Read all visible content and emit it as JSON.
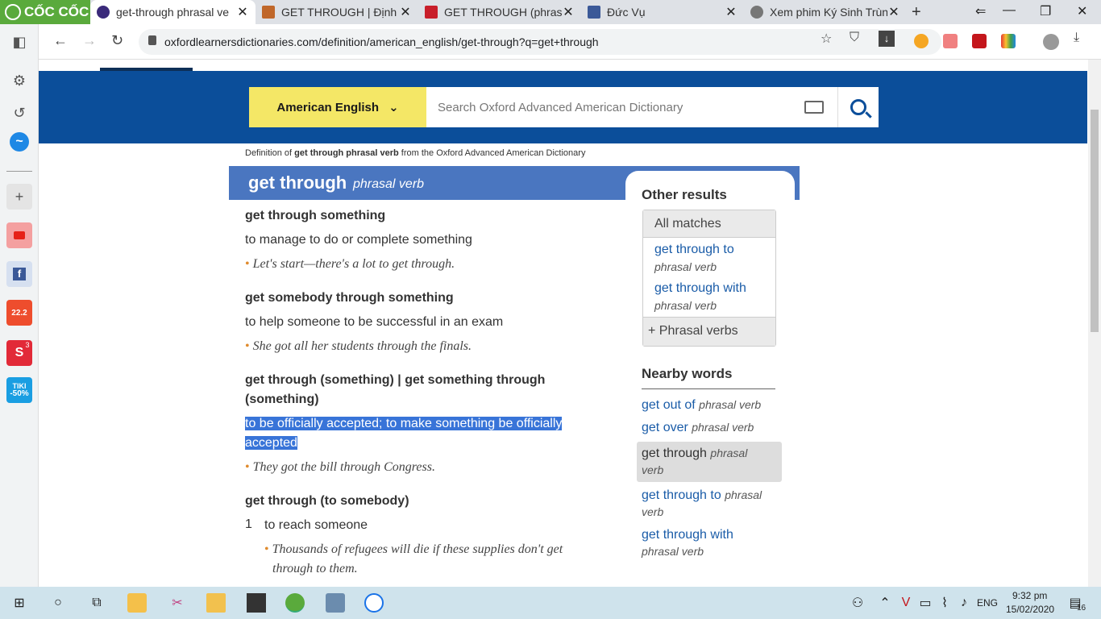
{
  "browser": {
    "brand": "CỐC CỐC",
    "tabs": [
      {
        "title": "get-through phrasal ve",
        "active": true
      },
      {
        "title": "GET THROUGH | Định n"
      },
      {
        "title": "GET THROUGH (phrasal"
      },
      {
        "title": "Đức Vụ"
      },
      {
        "title": "Xem phim Ký Sinh Trùng"
      }
    ],
    "url": "oxfordlearnersdictionaries.com/definition/american_english/get-through?q=get+through"
  },
  "site": {
    "dictionary_select": "American English",
    "search_placeholder": "Search Oxford Advanced American Dictionary",
    "definition_line": {
      "prefix": "Definition of ",
      "bold": "get through phrasal verb",
      "suffix": " from the Oxford Advanced American Dictionary"
    },
    "headword": "get through",
    "pos": "phrasal verb"
  },
  "entries": [
    {
      "phrase": "get through something",
      "definition": "to manage to do or complete something",
      "example": "Let's start—there's a lot to get through."
    },
    {
      "phrase": "get somebody through something",
      "definition": "to help someone to be successful in an exam",
      "example": "She got all her students through the finals."
    },
    {
      "phrase_line1": "get through (something) | get something through",
      "phrase_line2": "(something)",
      "definition_line1": "to be officially accepted; to make something be officially",
      "definition_line2": "accepted",
      "example": "They got the bill through Congress."
    },
    {
      "phrase": "get through (to somebody)",
      "number": "1",
      "definition": "to reach someone",
      "example_line1": "Thousands of refugees will die if these supplies don't get",
      "example_line2": "through to them."
    }
  ],
  "other_results": {
    "heading": "Other results",
    "all_matches": "All matches",
    "items": [
      {
        "text": "get through to",
        "pos": "phrasal verb"
      },
      {
        "text": "get through with",
        "pos": "phrasal verb"
      }
    ],
    "phrasal_verbs": "Phrasal verbs"
  },
  "nearby": {
    "heading": "Nearby words",
    "items": [
      {
        "text": "get out of",
        "pos": "phrasal verb"
      },
      {
        "text": "get over",
        "pos": "phrasal verb"
      },
      {
        "text": "get through",
        "pos": "phrasal",
        "pos2": "verb",
        "current": true
      },
      {
        "text": "get through to",
        "pos": "phrasal",
        "pos2": "verb"
      },
      {
        "text": "get through with",
        "pos2": "phrasal verb"
      }
    ]
  },
  "taskbar": {
    "lang": "ENG",
    "time": "9:32 pm",
    "date": "15/02/2020",
    "notif_count": "16"
  },
  "sidebar_badge": "3",
  "shopee_label": "22.2",
  "tiki_label": "TIKI",
  "tiki_discount": "-50%",
  "colors": {
    "banner": "#0b4e9a",
    "headbar": "#4a76c0",
    "dict_select": "#f4e766",
    "link": "#1a5ca8",
    "highlight": "#3874d8"
  }
}
